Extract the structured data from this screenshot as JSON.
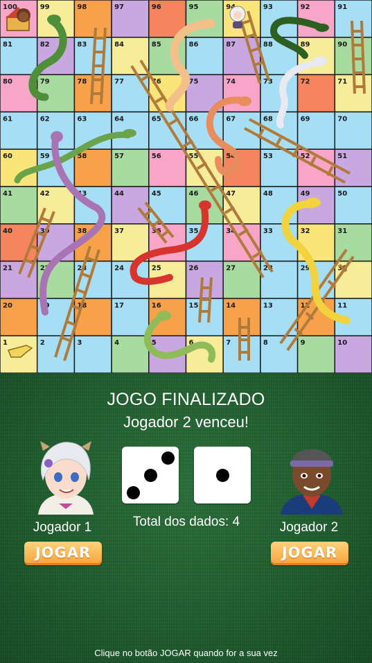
{
  "board": {
    "cells": [
      "100",
      "99",
      "98",
      "97",
      "96",
      "95",
      "94",
      "93",
      "92",
      "91",
      "81",
      "82",
      "83",
      "84",
      "85",
      "86",
      "87",
      "88",
      "89",
      "90",
      "80",
      "79",
      "78",
      "77",
      "76",
      "75",
      "74",
      "73",
      "72",
      "71",
      "61",
      "62",
      "63",
      "64",
      "65",
      "66",
      "67",
      "68",
      "69",
      "70",
      "60",
      "59",
      "58",
      "57",
      "56",
      "55",
      "54",
      "53",
      "52",
      "51",
      "41",
      "42",
      "43",
      "44",
      "45",
      "46",
      "47",
      "48",
      "49",
      "50",
      "40",
      "39",
      "38",
      "37",
      "36",
      "35",
      "34",
      "33",
      "32",
      "31",
      "21",
      "22",
      "23",
      "24",
      "25",
      "26",
      "27",
      "28",
      "29",
      "30",
      "20",
      "19",
      "18",
      "17",
      "16",
      "15",
      "14",
      "13",
      "12",
      "11",
      "1",
      "2",
      "3",
      "4",
      "5",
      "6",
      "7",
      "8",
      "9",
      "10"
    ],
    "colors": [
      "#f7a6c8",
      "#c9a7e0",
      "#fbe57a",
      "#a6dff5",
      "#f7a24a",
      "#a8dba0",
      "#f7a6c8",
      "#f6ec9a",
      "#f4855e",
      "#a6dff5"
    ]
  },
  "status": {
    "title": "JOGO FINALIZADO",
    "subtitle": "Jogador 2 venceu!"
  },
  "dice": {
    "die1": 3,
    "die2": 1,
    "total_label": "Total dos dados: 4"
  },
  "players": [
    {
      "name": "Jogador 1",
      "button": "JOGAR"
    },
    {
      "name": "Jogador 2",
      "button": "JOGAR"
    }
  ],
  "footer": "Clique no botão JOGAR quando for a sua vez"
}
